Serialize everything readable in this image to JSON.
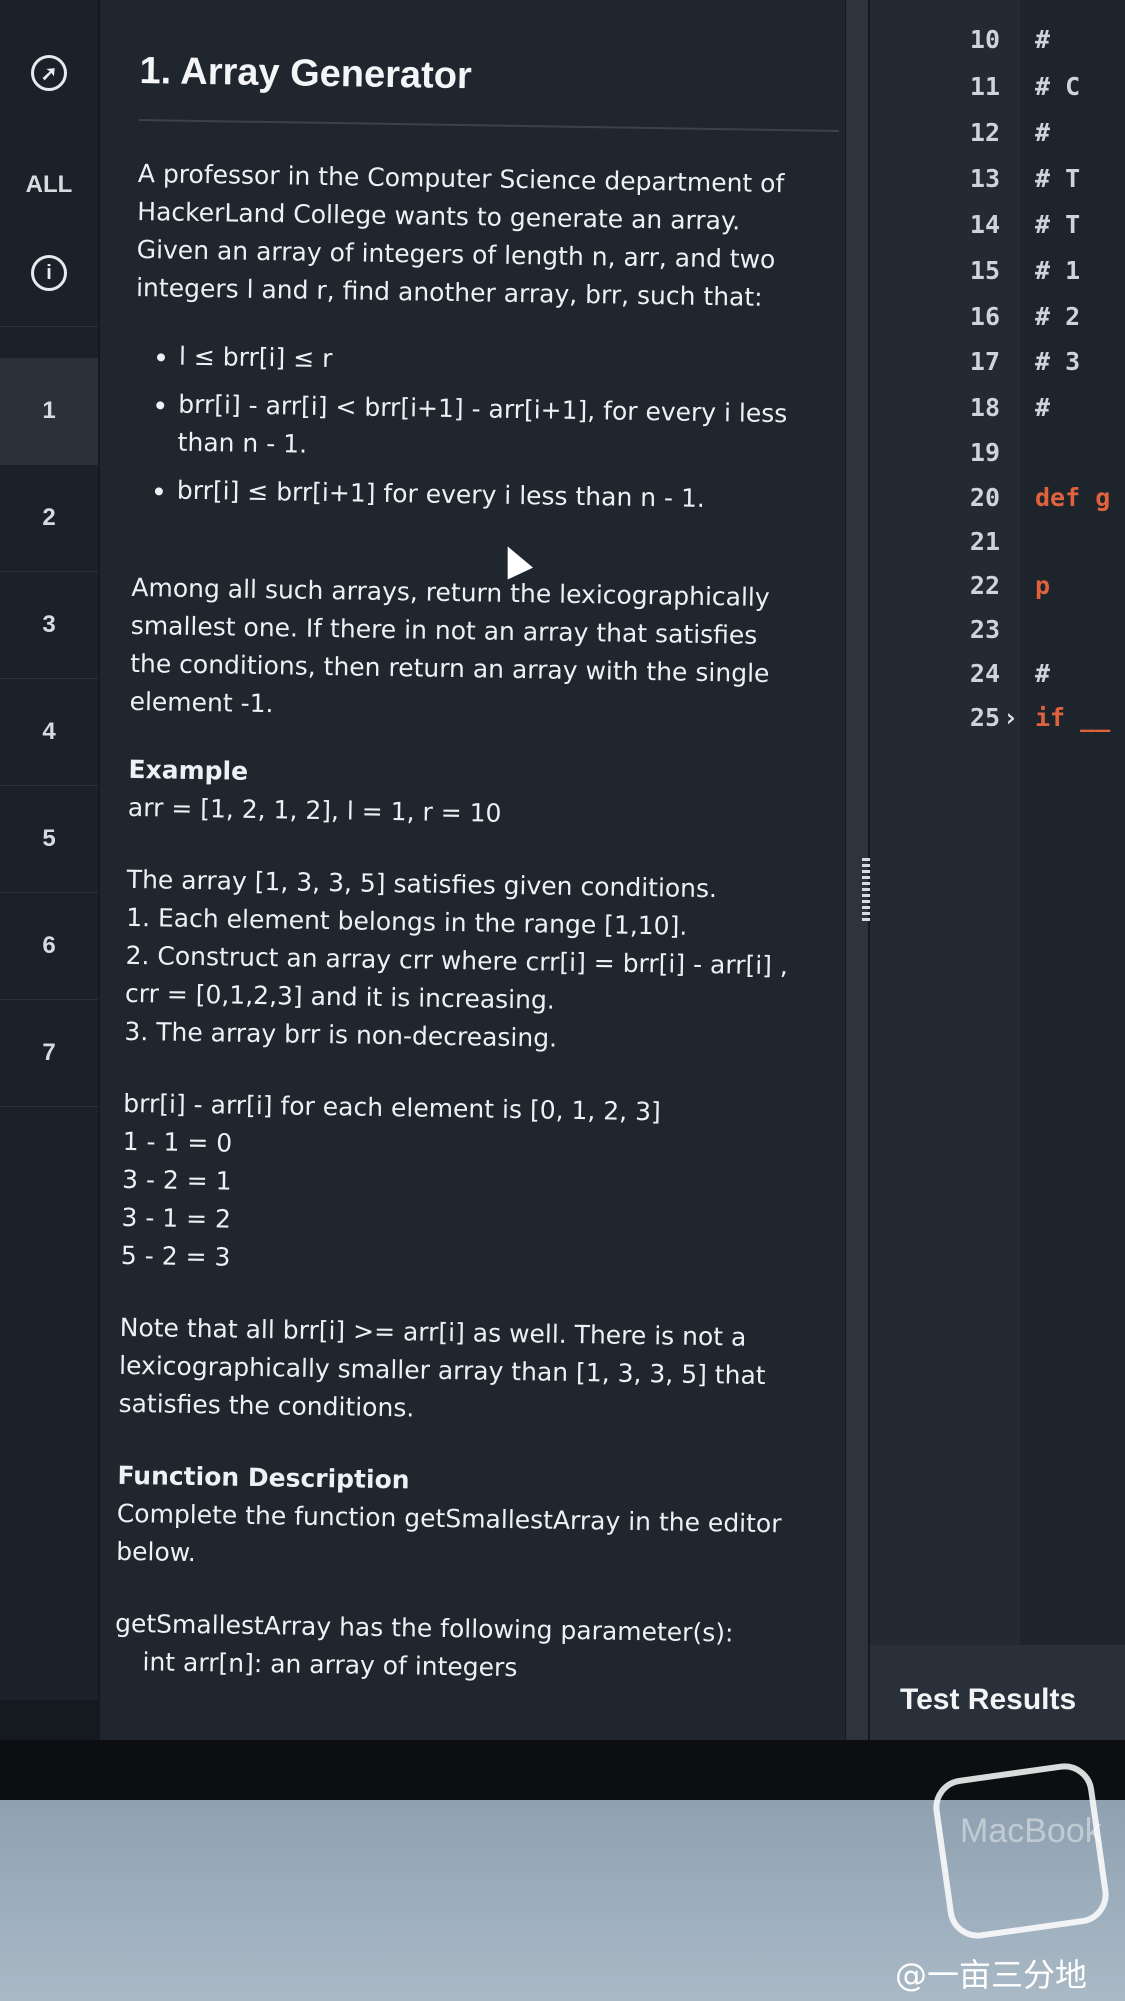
{
  "nav": {
    "items": [
      "ALL",
      "1",
      "2",
      "3",
      "4",
      "5",
      "6",
      "7"
    ],
    "active": "1"
  },
  "problem": {
    "title": "1. Array Generator",
    "intro": [
      "A professor in the Computer Science department of",
      "HackerLand College wants to generate an array.",
      "Given an array of integers of length n, arr, and two",
      "integers l and r, find another array, brr, such that:"
    ],
    "conditions": [
      "l ≤ brr[i] ≤ r",
      "brr[i] - arr[i] < brr[i+1] - arr[i+1], for every i less than n - 1.",
      "brr[i] ≤ brr[i+1] for every i less than n - 1."
    ],
    "return_text": [
      "Among all such arrays, return the lexicographically",
      "smallest one. If there in not an array that satisfies",
      "the conditions, then return an array with the single",
      "element -1."
    ],
    "example_heading": "Example",
    "example_input": "arr = [1, 2, 1, 2], l = 1, r = 10",
    "explanation": [
      "The array [1, 3, 3, 5] satisfies given conditions.",
      "1. Each element belongs in the range [1,10].",
      "2. Construct an array crr where crr[i] = brr[i] - arr[i] ,",
      "crr = [0,1,2,3] and it is increasing.",
      "3. The array brr is non-decreasing."
    ],
    "diff_lines": [
      "brr[i] - arr[i] for each element is [0, 1, 2, 3]",
      "1 - 1 = 0",
      "3 - 2 = 1",
      "3 - 1 = 2",
      "5 - 2 = 3"
    ],
    "note": [
      "Note that all brr[i] >= arr[i] as well. There is not a",
      "lexicographically smaller array than [1, 3, 3, 5] that",
      "satisfies the conditions."
    ],
    "function_heading": "Function Description",
    "function_text": [
      "Complete the function getSmallestArray in the editor",
      "below."
    ],
    "params_heading": "getSmallestArray has the following parameter(s):",
    "params": [
      "int arr[n]:  an array of integers"
    ]
  },
  "editor": {
    "line_numbers": [
      "10",
      "11",
      "12",
      "13",
      "14",
      "15",
      "16",
      "17",
      "18",
      "19",
      "20",
      "21",
      "22",
      "23",
      "24",
      "25"
    ],
    "code": [
      "#",
      "# C",
      "#",
      "# T",
      "# T",
      "#  1",
      "#  2",
      "#  3",
      "#",
      "",
      "def g",
      "",
      "    p",
      "",
      "    #",
      "if __"
    ]
  },
  "test_results": "Test Results",
  "device_brand": "MacBook",
  "watermark": "@一亩三分地"
}
